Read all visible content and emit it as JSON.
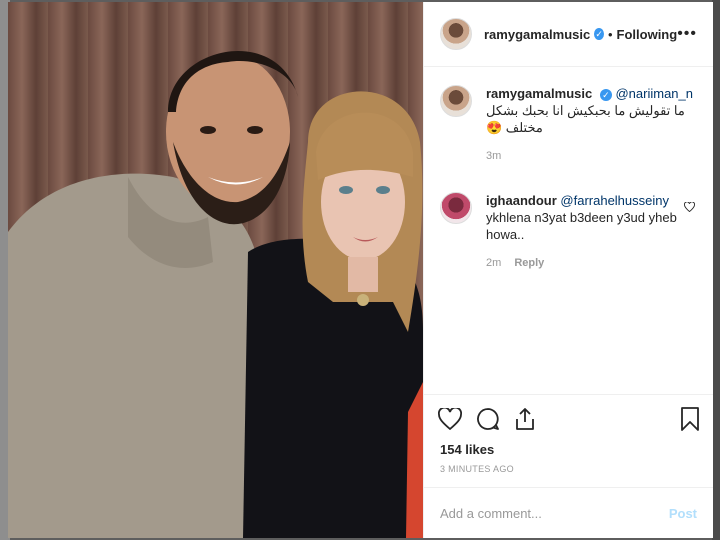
{
  "post": {
    "author": "ramygamalmusic",
    "verified_mark": "✓",
    "separator": "•",
    "follow_state": "Following",
    "more_label": "•••"
  },
  "comments": [
    {
      "username": "ramygamalmusic",
      "mention": "@nariiman_n",
      "text": "ما تقوليش ما بحبكيش انا بحبك بشكل مختلف 😍",
      "time": "3m",
      "reply_label": ""
    },
    {
      "username": "ighaandour",
      "mention": "@farrahelhusseiny",
      "text": "ykhlena n3yat b3deen y3ud yheb howa..",
      "time": "2m",
      "reply_label": "Reply"
    }
  ],
  "likes": "154 likes",
  "timestamp": "3 MINUTES AGO",
  "add_comment": {
    "placeholder": "Add a comment...",
    "post_label": "Post"
  },
  "icons": [
    "heart-icon",
    "comment-icon",
    "share-icon",
    "bookmark-icon",
    "more-icon",
    "verified-icon"
  ],
  "colors": {
    "verified": "#3897f0",
    "text": "#262626",
    "muted": "#999999",
    "post_disabled": "#b2dffc"
  }
}
